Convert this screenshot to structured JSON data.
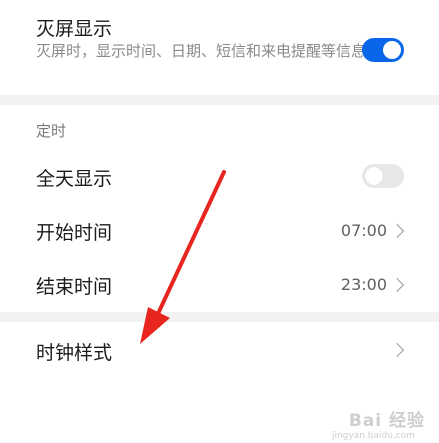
{
  "display": {
    "title": "灭屏显示",
    "description": "灭屏时，显示时间、日期、短信和来电提醒等信息",
    "toggle_state": "on"
  },
  "timer_section": {
    "title": "定时",
    "all_day": {
      "label": "全天显示",
      "toggle_state": "off"
    },
    "start": {
      "label": "开始时间",
      "value": "07:00"
    },
    "end": {
      "label": "结束时间",
      "value": "23:00"
    }
  },
  "clock_style": {
    "label": "时钟样式"
  },
  "watermark": {
    "text": "Bai 经验",
    "sub": "jingyan.baidu.com"
  },
  "colors": {
    "accent": "#0a66e8",
    "annotation_arrow": "#e8261f"
  }
}
